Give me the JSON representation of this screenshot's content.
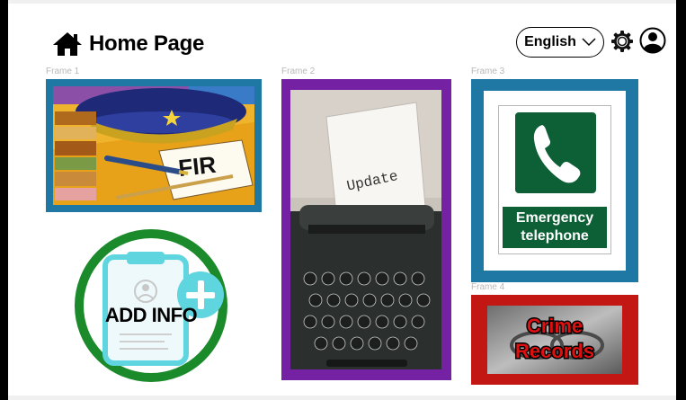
{
  "header": {
    "title": "Home Page",
    "home_icon": "home-icon",
    "language": "English",
    "settings_icon": "gear-icon",
    "profile_icon": "user-circle-icon"
  },
  "frames": {
    "frame1": {
      "label": "Frame 1",
      "image_text": "FIR"
    },
    "frame2": {
      "label": "Frame 2",
      "image_text": "Update"
    },
    "frame3": {
      "label": "Frame 3",
      "sign_line1": "Emergency",
      "sign_line2": "telephone"
    },
    "frame4": {
      "label": "Frame 4",
      "line1": "Crime",
      "line2": "Records"
    }
  },
  "add_info": {
    "label": "ADD INFO"
  },
  "colors": {
    "frame_blue": "#1f78a4",
    "frame_purple": "#7421a4",
    "frame_red": "#c21712",
    "add_ring_green": "#1b8a2a",
    "sign_green": "#0d5f35"
  }
}
